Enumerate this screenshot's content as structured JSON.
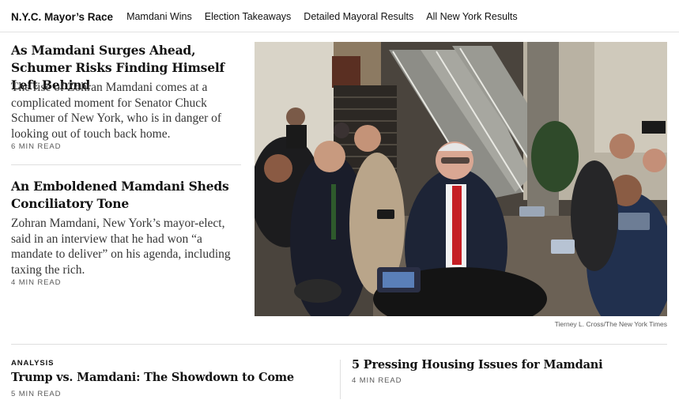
{
  "nav": {
    "title": "N.Y.C. Mayor’s Race",
    "links": [
      "Mamdani Wins",
      "Election Takeaways",
      "Detailed Mayoral Results",
      "All New York Results"
    ]
  },
  "stories": [
    {
      "headline": "As Mamdani Surges Ahead, Schumer Risks Finding Himself Left Behind",
      "summary": "The rise of Zohran Mamdani comes at a complicated moment for Senator Chuck Schumer of New York, who is in danger of looking out of touch back home.",
      "read_time": "6 MIN READ"
    },
    {
      "headline": "An Emboldened Mamdani Sheds Conciliatory Tone",
      "summary": "Zohran Mamdani, New York’s mayor-elect, said in an interview that he had won “a mandate to deliver” on his agenda, including taxing the rich.",
      "read_time": "4 MIN READ"
    }
  ],
  "photo": {
    "credit": "Tierney L. Cross/The New York Times"
  },
  "bottom": [
    {
      "kicker": "ANALYSIS",
      "headline": "Trump vs. Mamdani: The Showdown to Come",
      "read_time": "5 MIN READ"
    },
    {
      "headline": "5 Pressing Housing Issues for Mamdani",
      "read_time": "4 MIN READ"
    }
  ]
}
